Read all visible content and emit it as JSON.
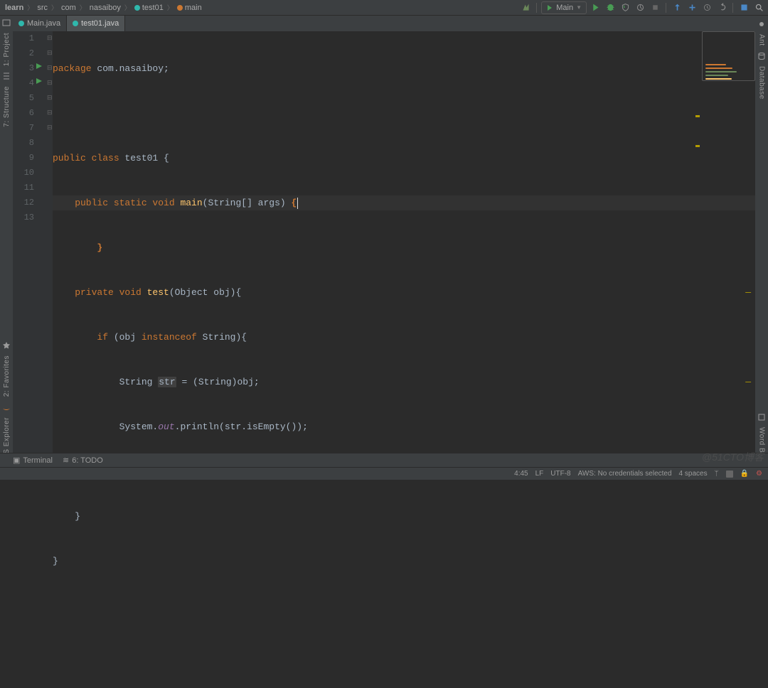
{
  "breadcrumbs": [
    {
      "label": "learn",
      "bold": true
    },
    {
      "label": "src"
    },
    {
      "label": "com"
    },
    {
      "label": "nasaiboy"
    },
    {
      "label": "test01",
      "icon": "cyan"
    },
    {
      "label": "main",
      "icon": "orange"
    }
  ],
  "run_config": {
    "label": "Main",
    "icon": "▸"
  },
  "tabs": [
    {
      "label": "Main.java",
      "icon": "cyan",
      "active": false
    },
    {
      "label": "test01.java",
      "icon": "cyan",
      "active": true
    }
  ],
  "left_panels": [
    {
      "label": "1: Project"
    },
    {
      "label": "7: Structure"
    },
    {
      "label": "2: Favorites"
    },
    {
      "label": "AWS Explorer"
    }
  ],
  "right_panels": [
    {
      "label": "Ant"
    },
    {
      "label": "Database"
    },
    {
      "label": "Word Book"
    }
  ],
  "lines": [
    "1",
    "2",
    "3",
    "4",
    "5",
    "6",
    "7",
    "8",
    "9",
    "10",
    "11",
    "12",
    "13"
  ],
  "code": {
    "l1": {
      "a": "package",
      "b": " com.nasaiboy",
      "c": ";"
    },
    "l3": {
      "a": "public class ",
      "b": "test01 ",
      "c": "{"
    },
    "l4": {
      "a": "    public static void ",
      "b": "main",
      "c": "(",
      "d": "String",
      "e": "[] args",
      "f": ")",
      " g": " ",
      "h": "{"
    },
    "l5": {
      "a": "        ",
      "b": "}"
    },
    "l6": {
      "a": "    private void ",
      "b": "test",
      "c": "(",
      "d": "Object obj",
      "e": ")",
      "f": "{"
    },
    "l7": {
      "a": "        if ",
      "b": "(obj ",
      "c": "instanceof",
      "d": " String",
      "e": ")",
      "f": "{"
    },
    "l8": {
      "a": "            String ",
      "b": "str",
      "c": " = (",
      "d": "String",
      "e": ")obj",
      "f": ";"
    },
    "l9": {
      "a": "            System.",
      "b": "out",
      "c": ".println(str.isEmpty())",
      "d": ";"
    },
    "l10": {
      "a": "        ",
      "b": "}"
    },
    "l11": {
      "a": "    ",
      "b": "}"
    },
    "l12": {
      "a": "",
      "b": "}"
    }
  },
  "warn_markers": [
    {
      "line": 6
    },
    {
      "line": 8
    }
  ],
  "bottom_tools": [
    {
      "icon": "▣",
      "label": "Terminal"
    },
    {
      "icon": "≡",
      "label": "6: TODO"
    }
  ],
  "status": {
    "pos": "4:45",
    "eol": "LF",
    "enc": "UTF-8",
    "aws": "AWS: No credentials selected",
    "indent": "4 spaces"
  },
  "watermark": "@51CTO博客"
}
